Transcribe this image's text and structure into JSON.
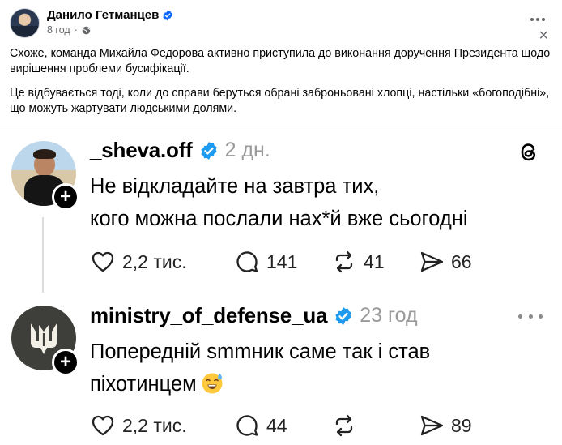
{
  "post": {
    "author": "Данило Гетманцев",
    "time": "8 год",
    "paragraph1": "Схоже, команда Михайла Федорова активно приступила до виконання доручення Президента щодо вирішення проблеми бусифікації.",
    "paragraph2": "Це відбувається тоді, коли до справи беруться обрані заброньовані хлопці, настільки «богоподібні», що можуть жартувати людськими долями.",
    "more_icon": "three-dots-icon",
    "close_label": "×"
  },
  "threads": [
    {
      "username": "_sheva.off",
      "time": "2 дн.",
      "text_line1": "Не відкладайте на завтра тих,",
      "text_line2": "кого можна послали нах*й вже сьогодні",
      "likes": "2,2 тис.",
      "replies": "141",
      "reposts": "41",
      "shares": "66"
    },
    {
      "username": "ministry_of_defense_ua",
      "time": "23 год",
      "text_line1": "Попередній smmник саме так і став",
      "text_line2": "піхотинцем",
      "likes": "2,2 тис.",
      "replies": "44",
      "reposts": "",
      "shares": "89"
    }
  ],
  "colors": {
    "verified_blue": "#1d9bf0",
    "fb_verified_blue": "#0866ff",
    "muted_gray": "#65676b"
  }
}
